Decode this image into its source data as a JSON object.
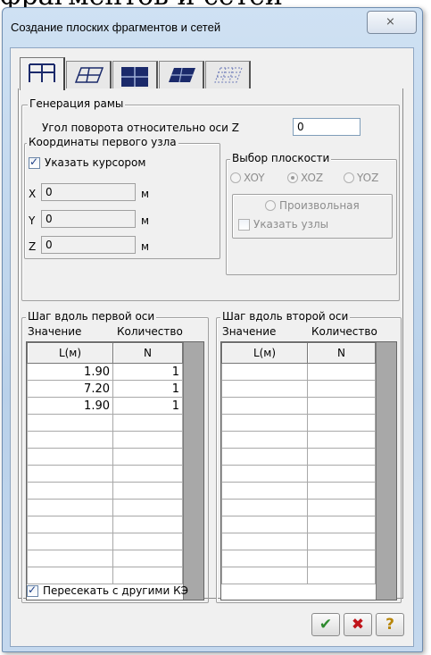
{
  "background_text": "фрагментов и сетей",
  "window": {
    "title": "Создание плоских фрагментов и сетей",
    "close_glyph": "⨯"
  },
  "tabs": [
    "frame-grid-icon",
    "plate-grid-icon",
    "quad-grid-icon",
    "inclined-plate-icon",
    "dotted-grid-icon"
  ],
  "frame_group": {
    "title": "Генерация рамы",
    "angle_label": "Угол поворота относительно оси Z",
    "angle_value": "0"
  },
  "first_node": {
    "title": "Координаты первого узла",
    "cursor_label": "Указать курсором",
    "cursor_checked": true,
    "x_label": "X",
    "x_value": "0",
    "y_label": "Y",
    "y_value": "0",
    "z_label": "Z",
    "z_value": "0",
    "unit": "м"
  },
  "plane": {
    "title": "Выбор плоскости",
    "xoy": "XOY",
    "xoz": "XOZ",
    "yoz": "YOZ",
    "selected": "XOZ",
    "arbitrary": "Произвольная",
    "nodes_label": "Указать узлы"
  },
  "axis1": {
    "title": "Шаг вдоль первой оси",
    "value_label": "Значение",
    "count_label": "Количество",
    "col_l": "L(м)",
    "col_n": "N",
    "rows": [
      {
        "l": "1.90",
        "n": "1"
      },
      {
        "l": "7.20",
        "n": "1"
      },
      {
        "l": "1.90",
        "n": "1"
      }
    ]
  },
  "axis2": {
    "title": "Шаг вдоль второй оси",
    "value_label": "Значение",
    "count_label": "Количество",
    "col_l": "L(м)",
    "col_n": "N",
    "rows": []
  },
  "intersect": {
    "label": "Пересекать с другими КЭ",
    "checked": true
  },
  "buttons": {
    "ok_glyph": "✔",
    "cancel_glyph": "✖",
    "help_glyph": "?"
  },
  "colors": {
    "ok": "#2f8a2f",
    "cancel": "#c0141a",
    "help": "#b8860b"
  }
}
